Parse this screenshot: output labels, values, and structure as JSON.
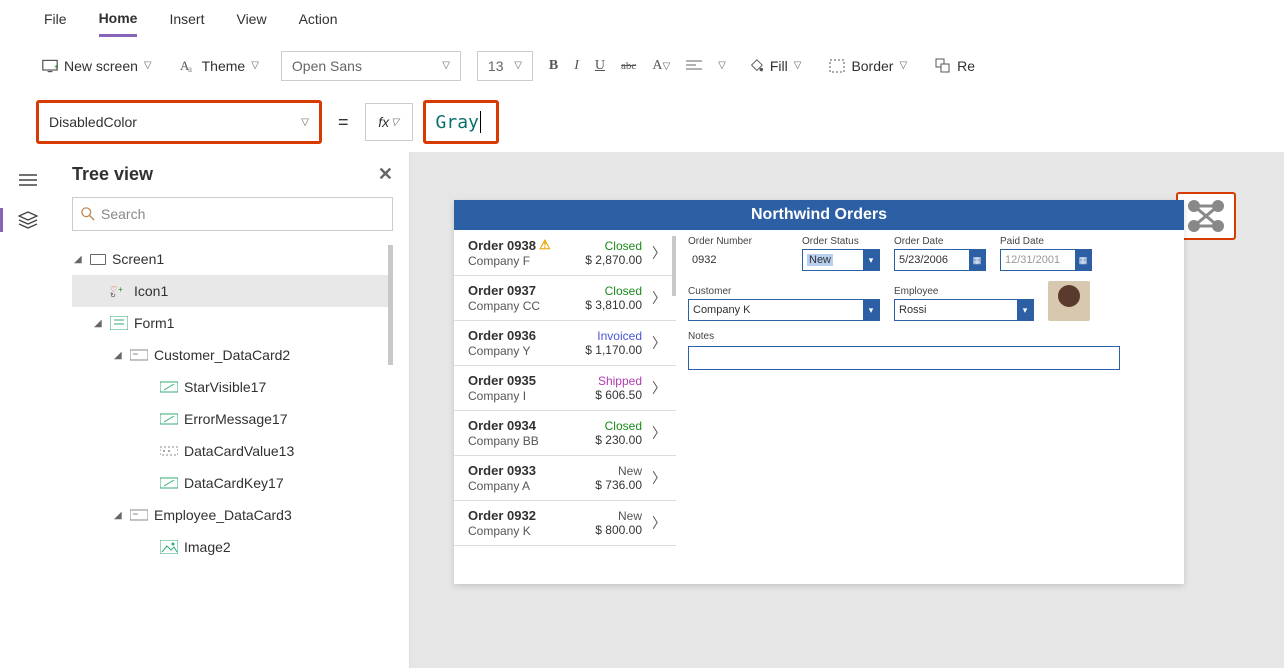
{
  "menu": {
    "file": "File",
    "home": "Home",
    "insert": "Insert",
    "view": "View",
    "action": "Action"
  },
  "toolbar": {
    "new_screen": "New screen",
    "theme": "Theme",
    "font": "Open Sans",
    "size": "13",
    "fill": "Fill",
    "border": "Border",
    "reorder": "Re"
  },
  "formula": {
    "property": "DisabledColor",
    "value": "Gray",
    "fx": "fx"
  },
  "tree": {
    "title": "Tree view",
    "search_ph": "Search",
    "nodes": {
      "screen1": "Screen1",
      "icon1": "Icon1",
      "form1": "Form1",
      "cust": "Customer_DataCard2",
      "star": "StarVisible17",
      "err": "ErrorMessage17",
      "val": "DataCardValue13",
      "key": "DataCardKey17",
      "emp": "Employee_DataCard3",
      "img": "Image2"
    }
  },
  "app": {
    "title": "Northwind Orders",
    "orders": [
      {
        "num": "Order 0938",
        "company": "Company F",
        "status": "Closed",
        "amount": "$ 2,870.00",
        "warn": true
      },
      {
        "num": "Order 0937",
        "company": "Company CC",
        "status": "Closed",
        "amount": "$ 3,810.00"
      },
      {
        "num": "Order 0936",
        "company": "Company Y",
        "status": "Invoiced",
        "amount": "$ 1,170.00"
      },
      {
        "num": "Order 0935",
        "company": "Company I",
        "status": "Shipped",
        "amount": "$ 606.50"
      },
      {
        "num": "Order 0934",
        "company": "Company BB",
        "status": "Closed",
        "amount": "$ 230.00"
      },
      {
        "num": "Order 0933",
        "company": "Company A",
        "status": "New",
        "amount": "$ 736.00"
      },
      {
        "num": "Order 0932",
        "company": "Company K",
        "status": "New",
        "amount": "$ 800.00"
      }
    ],
    "detail": {
      "order_number_label": "Order Number",
      "order_number": "0932",
      "order_status_label": "Order Status",
      "order_status": "New",
      "order_date_label": "Order Date",
      "order_date": "5/23/2006",
      "paid_date_label": "Paid Date",
      "paid_date": "12/31/2001",
      "customer_label": "Customer",
      "customer": "Company K",
      "employee_label": "Employee",
      "employee": "Rossi",
      "notes_label": "Notes"
    }
  }
}
